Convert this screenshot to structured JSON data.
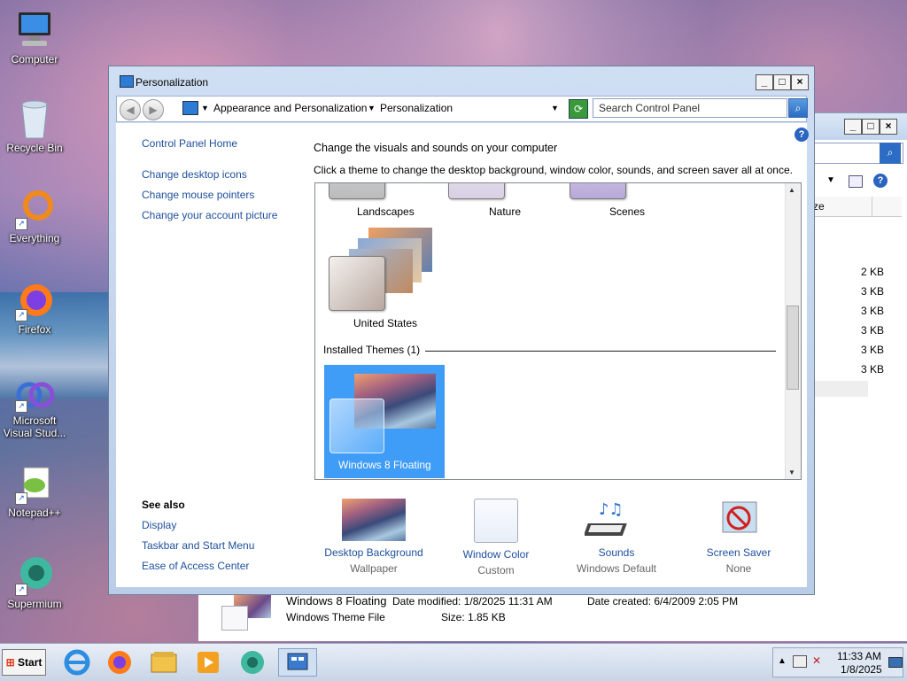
{
  "desktop_icons": [
    {
      "label": "Computer"
    },
    {
      "label": "Recycle Bin"
    },
    {
      "label": "Everything"
    },
    {
      "label": "Firefox"
    },
    {
      "label": "Microsoft Visual Stud..."
    },
    {
      "label": "Notepad++"
    },
    {
      "label": "Supermium"
    }
  ],
  "window": {
    "title": "Personalization",
    "breadcrumb": [
      "Appearance and Personalization",
      "Personalization"
    ],
    "search_placeholder": "Search Control Panel"
  },
  "sidebar": {
    "home": "Control Panel Home",
    "links": [
      "Change desktop icons",
      "Change mouse pointers",
      "Change your account picture"
    ],
    "see_also_title": "See also",
    "see_also": [
      "Display",
      "Taskbar and Start Menu",
      "Ease of Access Center"
    ]
  },
  "main": {
    "heading": "Change the visuals and sounds on your computer",
    "subheading": "Click a theme to change the desktop background, window color, sounds, and screen saver all at once.",
    "themes_row": [
      "Landscapes",
      "Nature",
      "Scenes"
    ],
    "theme_us": "United States",
    "installed_header": "Installed Themes (1)",
    "installed_theme": "Windows 8 Floating"
  },
  "bottom": [
    {
      "label": "Desktop Background",
      "sub": "Wallpaper"
    },
    {
      "label": "Window Color",
      "sub": "Custom"
    },
    {
      "label": "Sounds",
      "sub": "Windows Default"
    },
    {
      "label": "Screen Saver",
      "sub": "None"
    }
  ],
  "back_window": {
    "sizes": [
      "2 KB",
      "3 KB",
      "3 KB",
      "3 KB",
      "3 KB",
      "3 KB"
    ],
    "col_header": "ze"
  },
  "details": {
    "name": "Windows 8 Floating",
    "modified": "Date modified: 1/8/2025 11:31 AM",
    "created": "Date created: 6/4/2009 2:05 PM",
    "type": "Windows Theme File",
    "size": "Size: 1.85 KB"
  },
  "taskbar": {
    "start": "Start",
    "time": "11:33 AM",
    "date": "1/8/2025"
  },
  "colors": {
    "accent": "#3f9cf7",
    "link": "#1e4f9c"
  }
}
